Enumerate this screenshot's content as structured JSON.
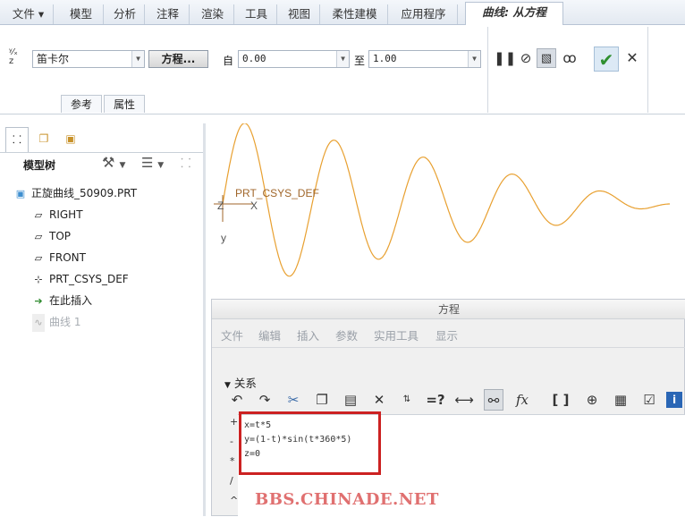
{
  "ribbon_tabs": [
    "文件",
    "模型",
    "分析",
    "注释",
    "渲染",
    "工具",
    "视图",
    "柔性建模",
    "应用程序"
  ],
  "active_tab": "曲线: 从方程",
  "coord_system": "笛卡尔",
  "equation_button": "方程...",
  "from_label": "自",
  "from_value": "0.00",
  "to_label": "至",
  "to_value": "1.00",
  "sub_tabs": [
    "参考",
    "属性"
  ],
  "tree": {
    "title": "模型树",
    "items": [
      "正旋曲线_50909.PRT",
      "RIGHT",
      "TOP",
      "FRONT",
      "PRT_CSYS_DEF",
      "在此插入",
      "曲线 1"
    ]
  },
  "viewport": {
    "csys_label": "PRT_CSYS_DEF",
    "axis_z": "Z",
    "axis_x": "X",
    "axis_y": "y",
    "curve_color": "#e8a030"
  },
  "dialog": {
    "title": "方程",
    "menu": [
      "文件",
      "编辑",
      "插入",
      "参数",
      "实用工具",
      "显示"
    ],
    "section": "关系",
    "toolbar": [
      "undo-icon",
      "redo-icon",
      "cut-icon",
      "copy-icon",
      "paste-icon",
      "delete-icon",
      "sort-icon",
      "verify-icon",
      "measure-icon",
      "view-icon",
      "function-icon",
      "brackets-icon",
      "calculator-icon",
      "parameter-icon",
      "check-icon",
      "info-icon"
    ],
    "equations": [
      "x=t*5",
      "y=(1-t)*sin(t*360*5)",
      "z=0"
    ],
    "side_ops": [
      "+",
      "-",
      "*",
      "/",
      "^"
    ],
    "highlight_color": "#cc2222"
  },
  "watermark": "BBS.CHINADE.NET"
}
